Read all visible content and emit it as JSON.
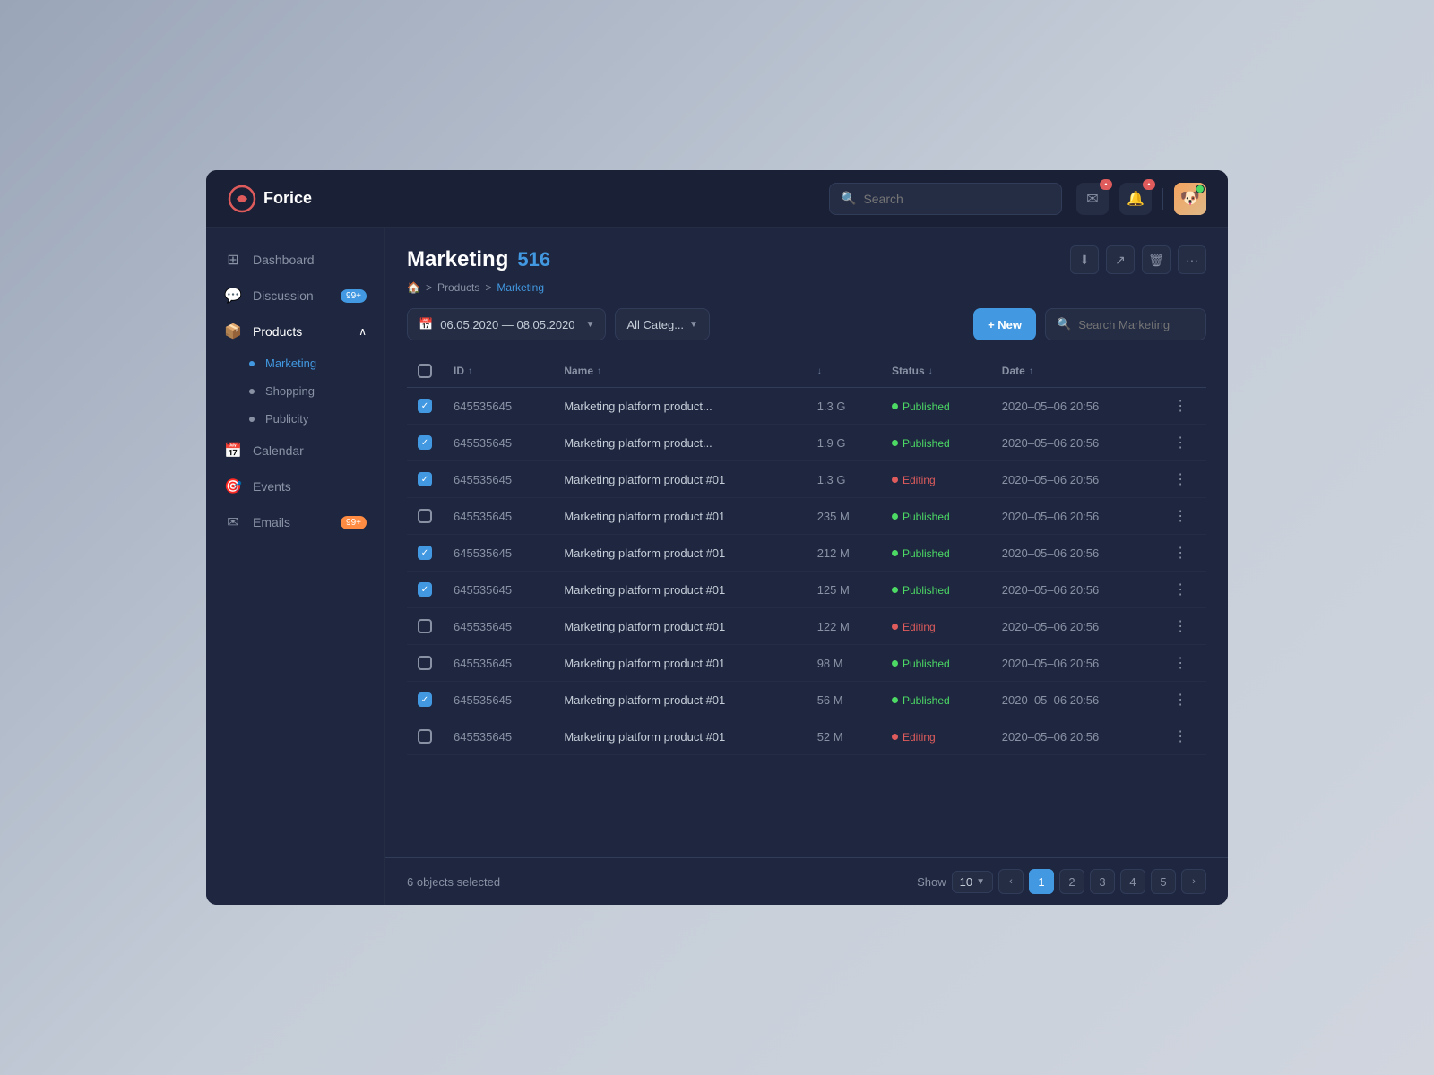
{
  "app": {
    "name": "Forice",
    "logo_icon": "🅾"
  },
  "header": {
    "search_placeholder": "Search",
    "mail_badge": "",
    "notif_badge": ""
  },
  "sidebar": {
    "items": [
      {
        "id": "dashboard",
        "label": "Dashboard",
        "icon": "⊞",
        "badge": null
      },
      {
        "id": "discussion",
        "label": "Discussion",
        "icon": "💬",
        "badge": "99+"
      },
      {
        "id": "products",
        "label": "Products",
        "icon": "📦",
        "badge": null,
        "expanded": true
      },
      {
        "id": "calendar",
        "label": "Calendar",
        "icon": "📅",
        "badge": null
      },
      {
        "id": "events",
        "label": "Events",
        "icon": "🎯",
        "badge": null
      },
      {
        "id": "emails",
        "label": "Emails",
        "icon": "✉",
        "badge": "99+"
      }
    ],
    "sub_items": [
      {
        "id": "marketing",
        "label": "Marketing",
        "active": true
      },
      {
        "id": "shopping",
        "label": "Shopping"
      },
      {
        "id": "publicity",
        "label": "Publicity"
      }
    ]
  },
  "page": {
    "title": "Marketing",
    "count": "516",
    "breadcrumb": [
      {
        "label": "🏠",
        "href": "#"
      },
      {
        "label": "Products",
        "href": "#"
      },
      {
        "label": "Marketing",
        "href": "#",
        "current": true
      }
    ]
  },
  "toolbar": {
    "date_range": "06.05.2020  —  08.05.2020",
    "category_label": "All Categ...",
    "new_button": "+ New",
    "search_placeholder": "Search Marketing"
  },
  "table": {
    "columns": [
      {
        "key": "checkbox",
        "label": ""
      },
      {
        "key": "id",
        "label": "ID",
        "sort": "↑"
      },
      {
        "key": "name",
        "label": "Name",
        "sort": "↑"
      },
      {
        "key": "size",
        "label": "",
        "sort": "↓"
      },
      {
        "key": "status",
        "label": "Status",
        "sort": "↓"
      },
      {
        "key": "date",
        "label": "Date",
        "sort": "↑"
      },
      {
        "key": "actions",
        "label": ""
      }
    ],
    "rows": [
      {
        "id": "645535645",
        "name": "Marketing platform product...",
        "size": "1.3 G",
        "status": "Published",
        "date": "2020–05–06 20:56",
        "checked": true
      },
      {
        "id": "645535645",
        "name": "Marketing platform product...",
        "size": "1.9 G",
        "status": "Published",
        "date": "2020–05–06 20:56",
        "checked": true
      },
      {
        "id": "645535645",
        "name": "Marketing platform product #01",
        "size": "1.3 G",
        "status": "Editing",
        "date": "2020–05–06 20:56",
        "checked": true
      },
      {
        "id": "645535645",
        "name": "Marketing platform product #01",
        "size": "235 M",
        "status": "Published",
        "date": "2020–05–06 20:56",
        "checked": false
      },
      {
        "id": "645535645",
        "name": "Marketing platform product #01",
        "size": "212 M",
        "status": "Published",
        "date": "2020–05–06 20:56",
        "checked": true
      },
      {
        "id": "645535645",
        "name": "Marketing platform product #01",
        "size": "125 M",
        "status": "Published",
        "date": "2020–05–06 20:56",
        "checked": true
      },
      {
        "id": "645535645",
        "name": "Marketing platform product #01",
        "size": "122 M",
        "status": "Editing",
        "date": "2020–05–06 20:56",
        "checked": false
      },
      {
        "id": "645535645",
        "name": "Marketing platform product #01",
        "size": "98 M",
        "status": "Published",
        "date": "2020–05–06 20:56",
        "checked": false
      },
      {
        "id": "645535645",
        "name": "Marketing platform product #01",
        "size": "56 M",
        "status": "Published",
        "date": "2020–05–06 20:56",
        "checked": true
      },
      {
        "id": "645535645",
        "name": "Marketing platform product #01",
        "size": "52 M",
        "status": "Editing",
        "date": "2020–05–06 20:56",
        "checked": false
      }
    ]
  },
  "footer": {
    "selected_count": "6 objects selected",
    "show_label": "Show",
    "show_value": "10",
    "pages": [
      "1",
      "2",
      "3",
      "4",
      "5"
    ]
  }
}
